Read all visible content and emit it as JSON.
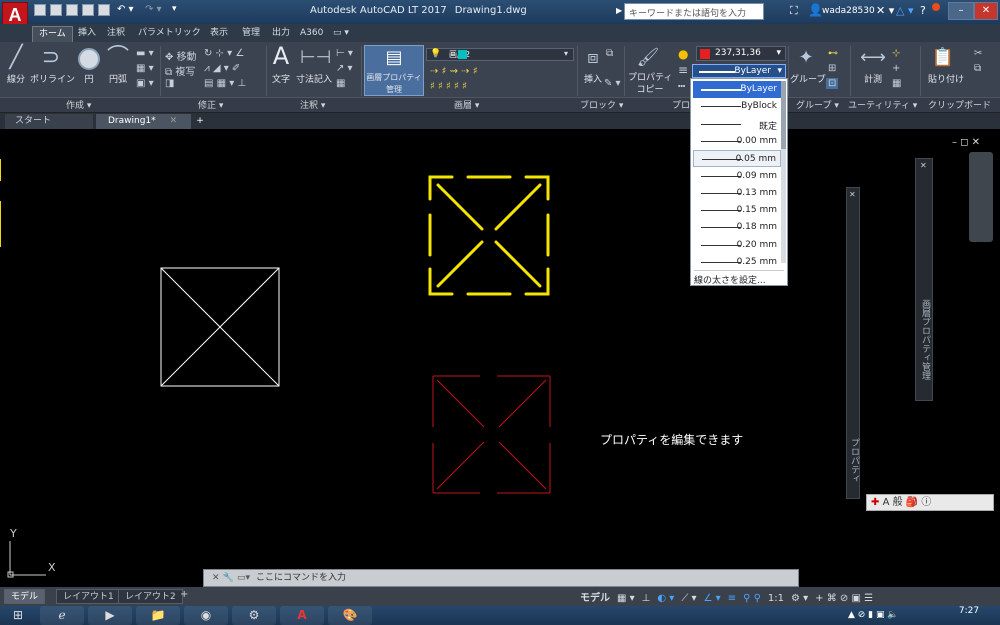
{
  "window": {
    "app_title": "Autodesk AutoCAD LT 2017",
    "doc_title": "Drawing1.dwg",
    "search_placeholder": "キーワードまたは語句を入力",
    "username": "wada28530",
    "logo_letter": "A",
    "logo_sub": "LT"
  },
  "ribbon_tabs": [
    "ホーム",
    "挿入",
    "注釈",
    "パラメトリック",
    "表示",
    "管理",
    "出力",
    "A360"
  ],
  "ribbon": {
    "draw": {
      "line": "線分",
      "polyline": "ポリライン",
      "circle": "円",
      "arc": "円弧"
    },
    "modify": {
      "move": "移動",
      "copy": "複写"
    },
    "annotation": {
      "text": "文字",
      "dimension": "寸法記入"
    },
    "layers": {
      "layer_props": "画層プロパティ",
      "manage": "管理",
      "current_layer": "画層2"
    },
    "block": {
      "insert": "挿入"
    },
    "properties": {
      "match": "プロパティ",
      "copy": "コピー",
      "color_value": "237,31,36",
      "lineweight_value": "ByLayer"
    },
    "groups": {
      "group": "グループ"
    },
    "utilities": {
      "measure": "計測"
    },
    "clipboard": {
      "paste": "貼り付け"
    }
  },
  "panel_labels": {
    "draw": "作成 ▾",
    "modify": "修正 ▾",
    "annotation": "注釈 ▾",
    "layers": "画層 ▾",
    "block": "ブロック ▾",
    "properties": "プロ",
    "groups": "グループ ▾",
    "utilities": "ユーティリティ ▾",
    "clipboard": "クリップボード"
  },
  "doc_tabs": {
    "start": "スタート",
    "drawing": "Drawing1*",
    "plus": "+"
  },
  "lineweight_dropdown": {
    "items": [
      "ByLayer",
      "ByBlock",
      "既定",
      "0.00 mm",
      "0.05 mm",
      "0.09 mm",
      "0.13 mm",
      "0.15 mm",
      "0.18 mm",
      "0.20 mm",
      "0.25 mm"
    ],
    "selected": "ByLayer",
    "hover": "0.05 mm",
    "footer": "線の太さを設定..."
  },
  "canvas": {
    "annotation": "プロパティを編集できます",
    "ucs_x": "X",
    "ucs_y": "Y"
  },
  "palettes": {
    "properties_title": "プロパティ",
    "layer_props_title": "画層プロパティ管理"
  },
  "ime": {
    "text": "A 般"
  },
  "command_line": {
    "placeholder": "ここにコマンドを入力"
  },
  "layout_tabs": [
    "モデル",
    "レイアウト1",
    "レイアウト2"
  ],
  "status_bar": {
    "model": "モデル",
    "scale": "1:1"
  },
  "taskbar": {
    "time": "7:27"
  },
  "colors": {
    "yellow_shape": "#f5e400",
    "white_shape": "#ffffff",
    "red_shape": "#c0161b",
    "accent": "#2f6bd1"
  }
}
